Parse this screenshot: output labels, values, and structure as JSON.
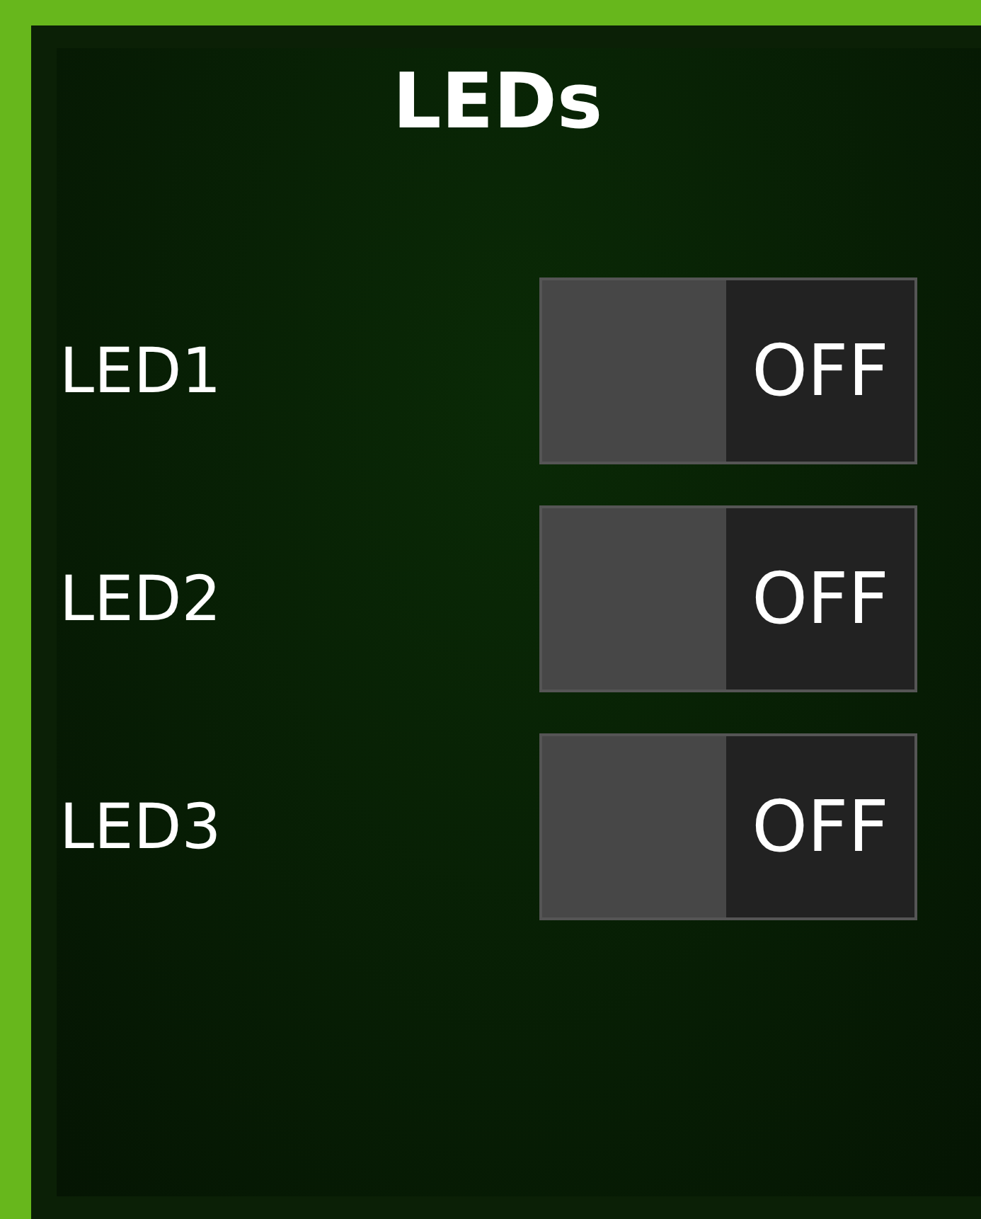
{
  "panel": {
    "title": "LEDs"
  },
  "leds": [
    {
      "label": "LED1",
      "on": false,
      "state_label": "OFF"
    },
    {
      "label": "LED2",
      "on": false,
      "state_label": "OFF"
    },
    {
      "label": "LED3",
      "on": false,
      "state_label": "OFF"
    }
  ]
}
